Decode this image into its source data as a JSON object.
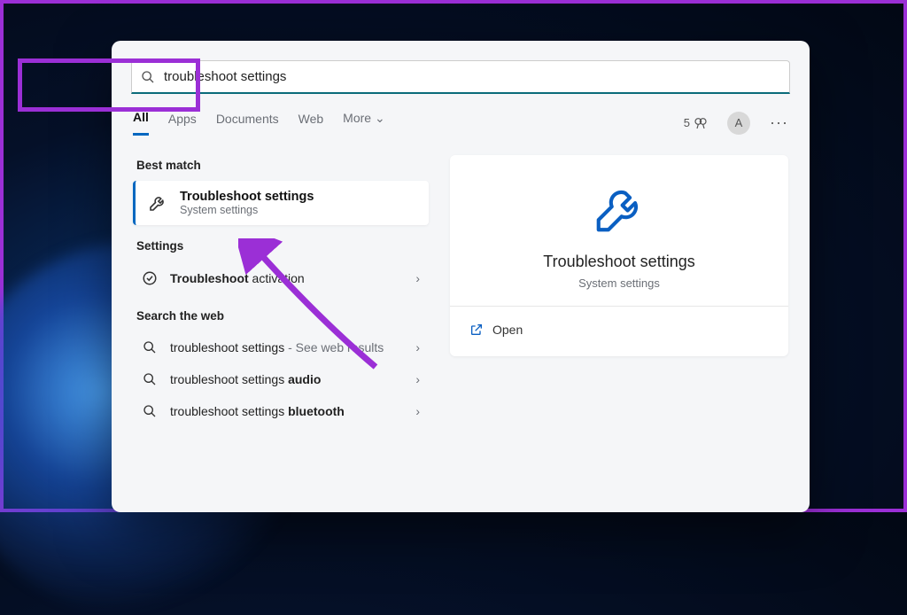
{
  "search": {
    "query": "troubleshoot settings"
  },
  "tabs": {
    "all": "All",
    "apps": "Apps",
    "documents": "Documents",
    "web": "Web",
    "more": "More"
  },
  "header": {
    "rewards_count": "5",
    "avatar_letter": "A"
  },
  "sections": {
    "best_match": "Best match",
    "settings": "Settings",
    "search_web": "Search the web"
  },
  "best_match": {
    "title": "Troubleshoot settings",
    "subtitle": "System settings"
  },
  "settings_items": {
    "activation_prefix": "Troubleshoot",
    "activation_suffix": " activation"
  },
  "web_items": {
    "i1_text": "troubleshoot settings",
    "i1_hint": " - See web results",
    "i2_prefix": "troubleshoot settings ",
    "i2_bold": "audio",
    "i3_prefix": "troubleshoot settings ",
    "i3_bold": "bluetooth"
  },
  "detail": {
    "title": "Troubleshoot settings",
    "subtitle": "System settings",
    "open": "Open"
  }
}
